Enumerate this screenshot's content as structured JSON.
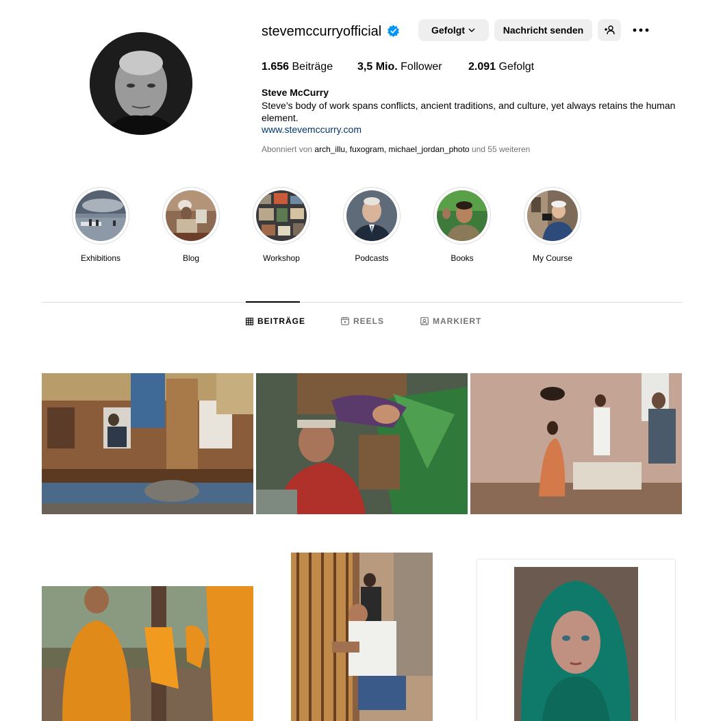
{
  "profile": {
    "username": "stevemccurryofficial",
    "verified": true,
    "full_name": "Steve McCurry",
    "bio": "Steve’s body of work spans conflicts, ancient traditions, and culture, yet always retains the human element.",
    "website": "www.stevemccurry.com",
    "followed_by": {
      "prefix": "Abonniert von",
      "users": [
        "arch_illu",
        "fuxogram",
        "michael_jordan_photo"
      ],
      "suffix": "und 55 weiteren"
    }
  },
  "buttons": {
    "following": "Gefolgt",
    "message": "Nachricht senden"
  },
  "stats": {
    "posts_value": "1.656",
    "posts_label": "Beiträge",
    "followers_value": "3,5 Mio.",
    "followers_label": "Follower",
    "following_value": "2.091",
    "following_label": "Gefolgt"
  },
  "highlights": [
    {
      "label": "Exhibitions"
    },
    {
      "label": "Blog"
    },
    {
      "label": "Workshop"
    },
    {
      "label": "Podcasts"
    },
    {
      "label": "Books"
    },
    {
      "label": "My Course"
    }
  ],
  "tabs": [
    {
      "label": "BEITRÄGE",
      "active": true
    },
    {
      "label": "REELS",
      "active": false
    },
    {
      "label": "MARKIERT",
      "active": false
    }
  ],
  "colors": {
    "verified_blue": "#0095f6",
    "link_blue": "#00376b",
    "button_bg": "#efefef",
    "muted_text": "#737373",
    "divider": "#dbdbdb"
  }
}
